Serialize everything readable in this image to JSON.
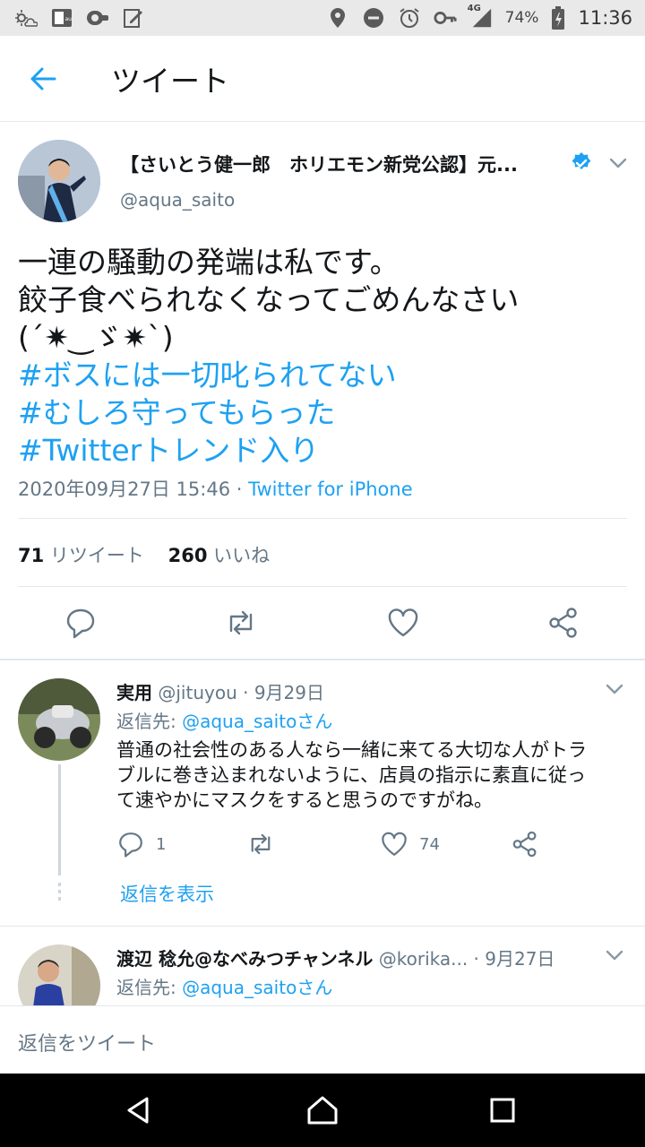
{
  "status_bar": {
    "battery": "74%",
    "network": "4G",
    "time": "11:36",
    "icons_left": [
      "weather-icon",
      "carrier-icon",
      "app-icon",
      "edit-icon"
    ],
    "icons_right": [
      "location-icon",
      "dnd-icon",
      "alarm-icon",
      "key-icon",
      "signal-icon",
      "battery-icon"
    ]
  },
  "app_bar": {
    "title": "ツイート",
    "back_icon": "arrow-left-icon"
  },
  "main_tweet": {
    "display_name": "【さいとう健一郎　ホリエモン新党公認】元...",
    "handle": "@aqua_saito",
    "verified": true,
    "lines": [
      "一連の騒動の発端は私です。",
      "餃子食べられなくなってごめんなさい",
      "(´✷‿ゞ✷`)"
    ],
    "hashtags": [
      "#ボスには一切叱られてない",
      "#むしろ守ってもらった",
      "#Twitterトレンド入り"
    ],
    "timestamp": "2020年09月27日 15:46",
    "separator": " · ",
    "source": "Twitter for iPhone",
    "retweet_count": "71",
    "retweet_label": "リツイート",
    "like_count": "260",
    "like_label": "いいね"
  },
  "replies": [
    {
      "name": "実用",
      "handle": "@jituyou",
      "date": "· 9月29日",
      "reply_prefix": "返信先: ",
      "reply_to": "@aqua_saitoさん",
      "text_lines": [
        "普通の社会性のある人なら一緒に来てる大切な人がトラ",
        "ブルに巻き込まれないように、店員の指示に素直に従っ",
        "て速やかにマスクをすると思うのですがね。"
      ],
      "reply_count": "1",
      "retweet_count": "",
      "like_count": "74",
      "show_replies": "返信を表示"
    },
    {
      "name": "渡辺 稔允@なべみつチャンネル",
      "handle": "@korika...",
      "date": "· 9月27日",
      "reply_prefix": "返信先: ",
      "reply_to": "@aqua_saitoさん"
    }
  ],
  "compose": {
    "placeholder": "返信をツイート"
  },
  "colors": {
    "accent": "#1da1f2",
    "secondary_text": "#657786",
    "border": "#e1e8ed"
  }
}
